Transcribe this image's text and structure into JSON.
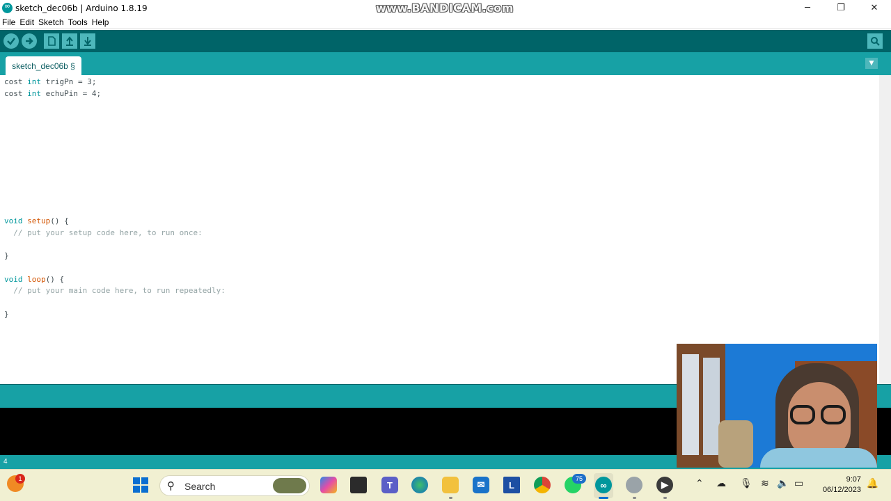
{
  "window": {
    "title": "sketch_dec06b | Arduino 1.8.19",
    "watermark": "www.BANDICAM.com",
    "controls": {
      "minimize": "─",
      "maximize": "❐",
      "close": "✕"
    }
  },
  "menu": [
    "File",
    "Edit",
    "Sketch",
    "Tools",
    "Help"
  ],
  "toolbar": {
    "verify_icon": "checkmark-icon",
    "upload_icon": "arrow-right-icon",
    "new_icon": "new-file-icon",
    "open_icon": "arrow-up-icon",
    "save_icon": "arrow-down-icon",
    "serial_monitor_icon": "magnifier-icon"
  },
  "tabs": [
    {
      "label": "sketch_dec06b §"
    }
  ],
  "tab_menu_icon": "▼",
  "editor": {
    "lines": [
      "cost int trigPn = 3;",
      "cost int echuPin = 4;",
      "",
      "",
      "",
      "",
      "",
      "",
      "",
      "",
      "",
      "",
      "void setup() {",
      "  // put your setup code here, to run once:",
      "",
      "}",
      "",
      "void loop() {",
      "  // put your main code here, to run repeatedly:",
      "",
      "}"
    ]
  },
  "status": {
    "line_number": "4"
  },
  "taskbar": {
    "weather_badge": "1",
    "search_label": "Search",
    "whatsapp_badge": "75",
    "time": "9:07",
    "date": "06/12/2023"
  },
  "colors": {
    "toolbar_dark": "#006468",
    "teal": "#17a1a5",
    "keyword": "#00979c",
    "function": "#d35400",
    "comment": "#95a5a6",
    "console": "#000000",
    "taskbar": "#f1f0d2"
  }
}
